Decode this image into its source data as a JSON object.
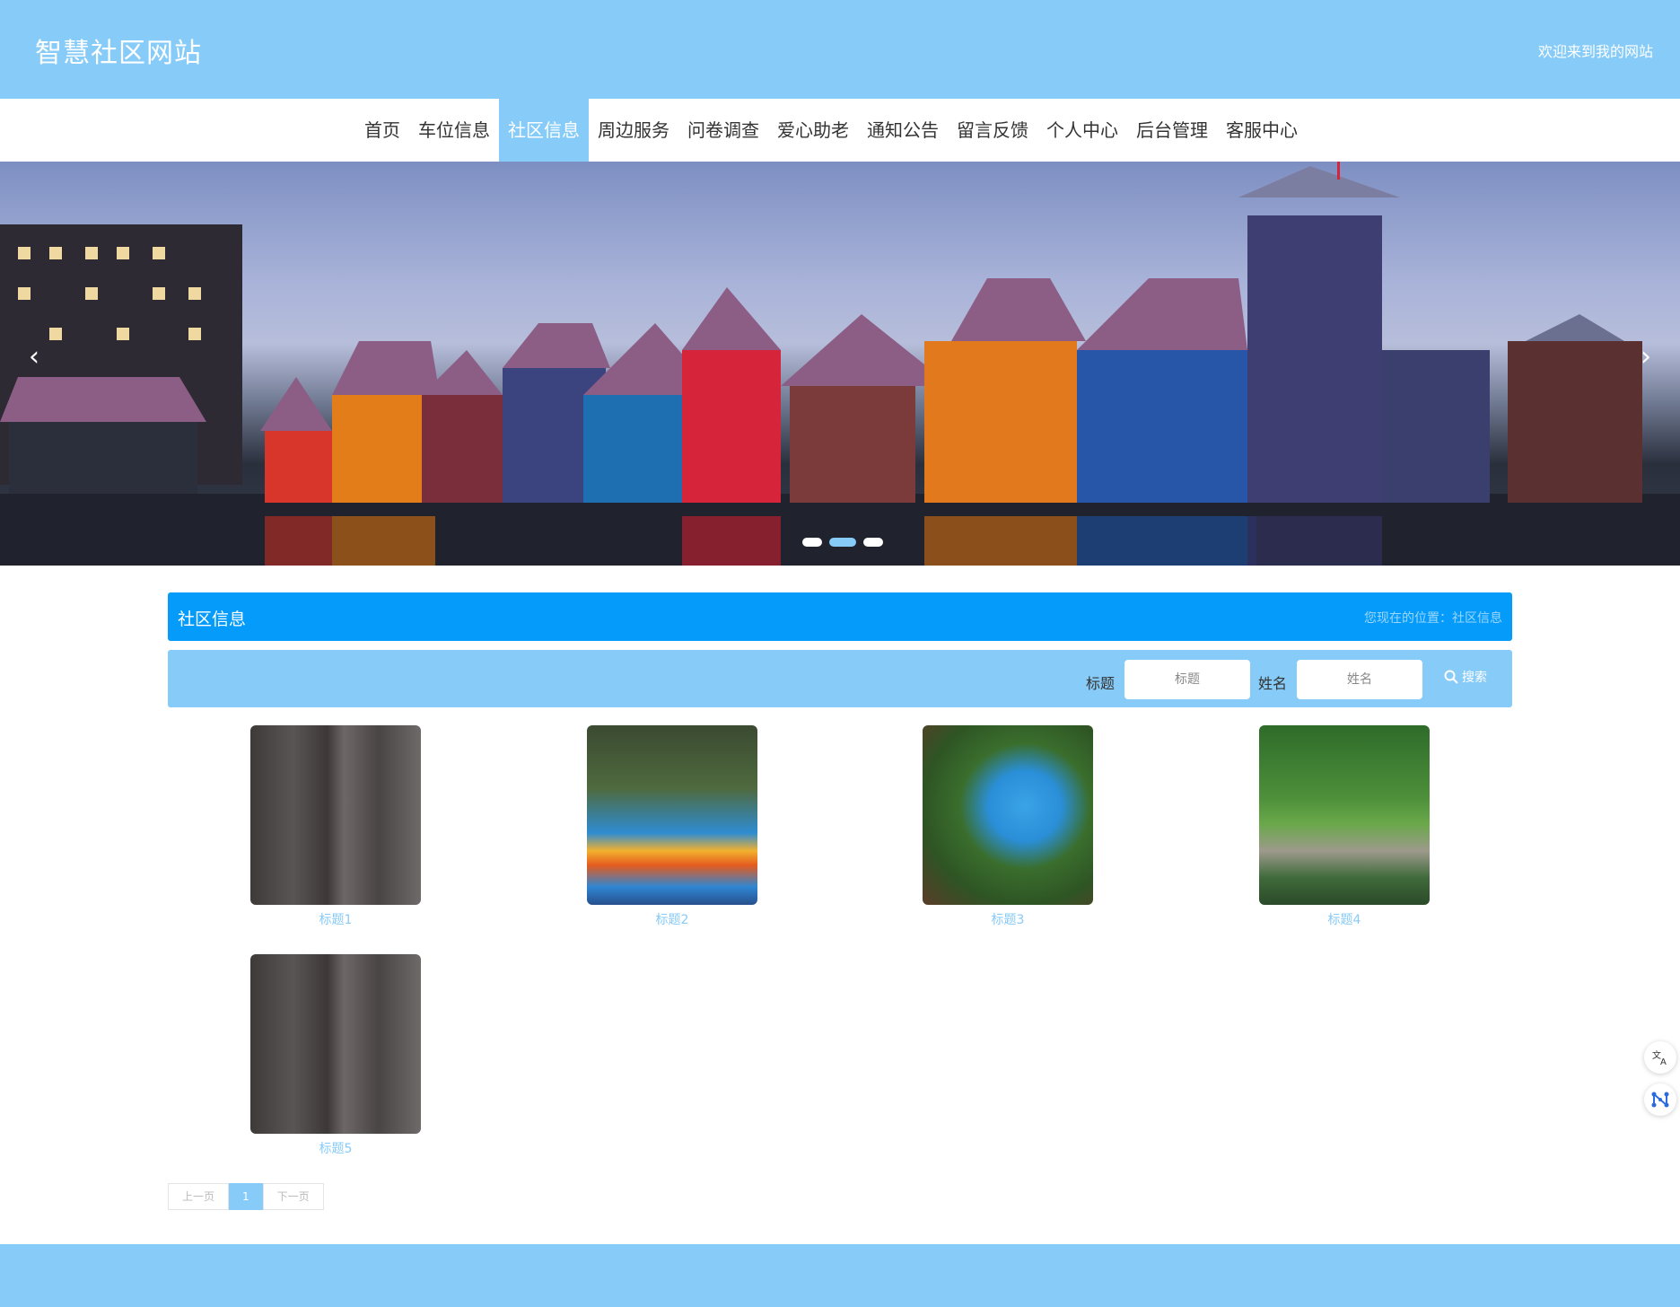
{
  "header": {
    "site_title": "智慧社区网站",
    "welcome": "欢迎来到我的网站"
  },
  "nav": {
    "items": [
      {
        "label": "首页"
      },
      {
        "label": "车位信息"
      },
      {
        "label": "社区信息",
        "active": true
      },
      {
        "label": "周边服务"
      },
      {
        "label": "问卷调查"
      },
      {
        "label": "爱心助老"
      },
      {
        "label": "通知公告"
      },
      {
        "label": "留言反馈"
      },
      {
        "label": "个人中心"
      },
      {
        "label": "后台管理"
      },
      {
        "label": "客服中心"
      }
    ]
  },
  "banner": {
    "prev_icon": "chevron-left-icon",
    "next_icon": "chevron-right-icon",
    "slide_count": 3,
    "active_slide": 2
  },
  "section": {
    "title": "社区信息",
    "breadcrumb": "您现在的位置：社区信息"
  },
  "search": {
    "title_label": "标题",
    "title_placeholder": "标题",
    "name_label": "姓名",
    "name_placeholder": "姓名",
    "button_label": "搜索",
    "button_icon": "search-icon"
  },
  "items": [
    {
      "caption": "标题1",
      "image": "elevator"
    },
    {
      "caption": "标题2",
      "image": "playground"
    },
    {
      "caption": "标题3",
      "image": "pool"
    },
    {
      "caption": "标题4",
      "image": "garden"
    },
    {
      "caption": "标题5",
      "image": "elevator"
    }
  ],
  "pagination": {
    "prev": "上一页",
    "current": "1",
    "next": "下一页"
  },
  "colors": {
    "primary": "#87cbf8",
    "section_bar": "#049bfa",
    "nav_active": "#87cbf8"
  },
  "floating": {
    "translate_icon": "translate-icon",
    "network_icon": "network-icon"
  }
}
